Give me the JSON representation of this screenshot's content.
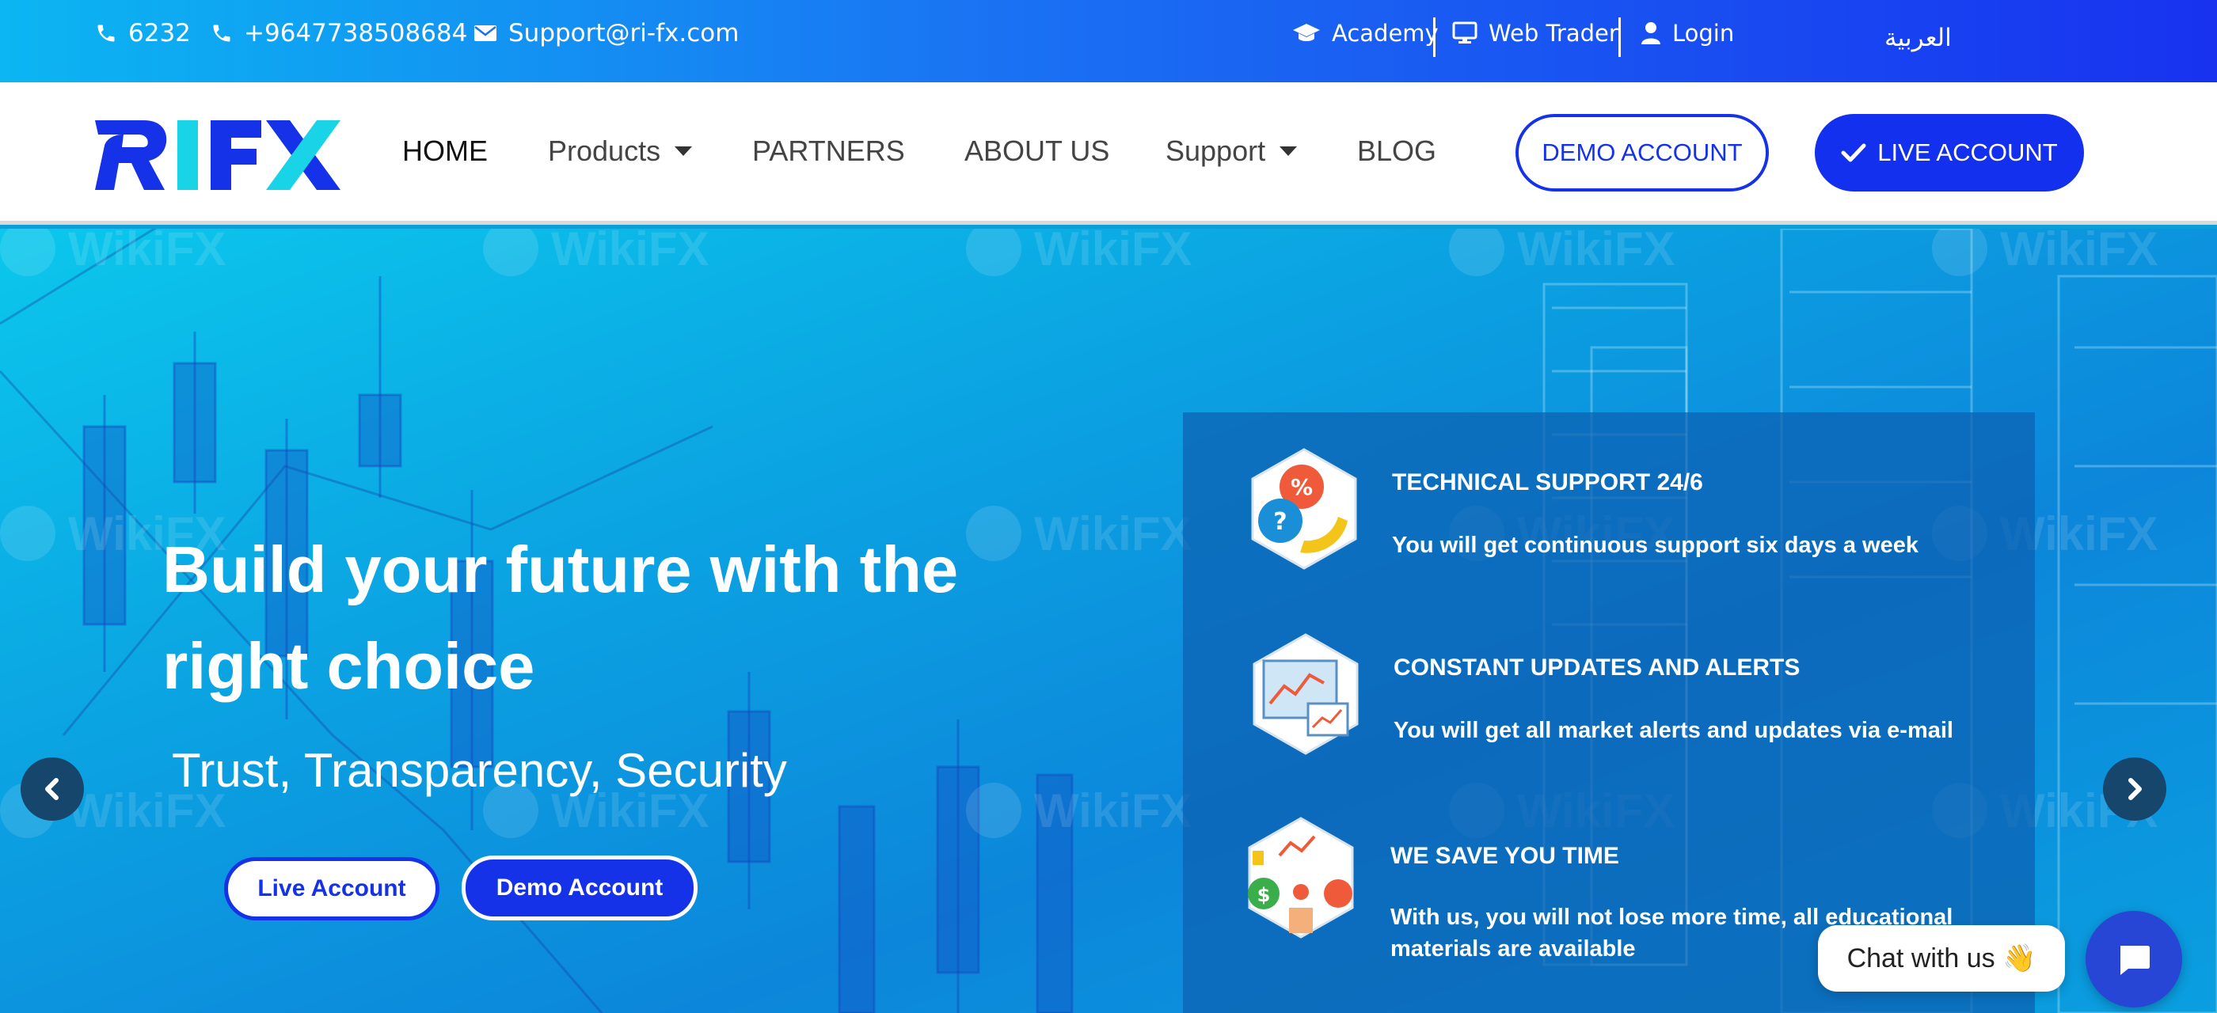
{
  "topbar": {
    "phone_short": "6232",
    "phone_long": "+9647738508684",
    "email": "Support@ri-fx.com",
    "academy": "Academy",
    "web_trader": "Web Trader",
    "login": "Login",
    "language": "العربية"
  },
  "logo": {
    "text": "RIFX"
  },
  "nav": {
    "home": "HOME",
    "products": "Products",
    "partners": "PARTNERS",
    "about": "ABOUT US",
    "support": "Support",
    "blog": "BLOG",
    "demo_account": "DEMO ACCOUNT",
    "live_account": "LIVE ACCOUNT"
  },
  "hero": {
    "title": "Build your future with the right choice",
    "subtitle": "Trust, Transparency, Security",
    "live_button": "Live Account",
    "demo_button": "Demo Account"
  },
  "features": [
    {
      "title": "TECHNICAL SUPPORT 24/6",
      "text": "You will get continuous support six days a week",
      "icon": "support-phone-icon"
    },
    {
      "title": "CONSTANT UPDATES AND ALERTS",
      "text": "You will get all market alerts and updates via e-mail",
      "icon": "market-alerts-icon"
    },
    {
      "title": "WE SAVE YOU TIME",
      "text": "With us, you will not lose more time, all educational materials are available",
      "icon": "time-saving-icon"
    }
  ],
  "watermark": "WikiFX",
  "chat": {
    "label": "Chat with us 👋"
  },
  "colors": {
    "brand_blue": "#1532e8",
    "accent_cyan": "#19d3e6"
  }
}
